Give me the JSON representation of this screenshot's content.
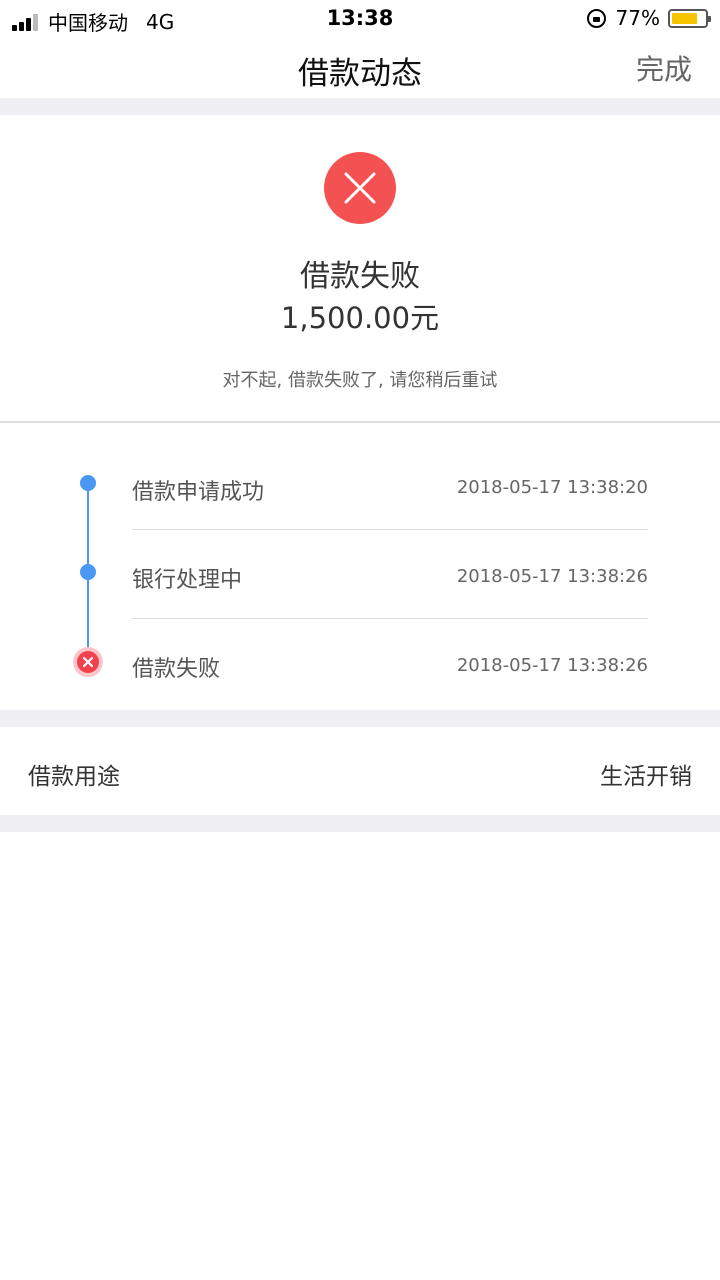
{
  "status_bar": {
    "carrier": "中国移动",
    "network": "4G",
    "time": "13:38",
    "battery": "77%",
    "battery_level": 0.77
  },
  "nav": {
    "title": "借款动态",
    "done_label": "完成"
  },
  "result": {
    "title": "借款失败",
    "amount": "1,500.00元",
    "message": "对不起, 借款失败了, 请您稍后重试"
  },
  "timeline": [
    {
      "label": "借款申请成功",
      "time": "2018-05-17 13:38:20",
      "state": "done"
    },
    {
      "label": "银行处理中",
      "time": "2018-05-17 13:38:26",
      "state": "done"
    },
    {
      "label": "借款失败",
      "time": "2018-05-17 13:38:26",
      "state": "failed"
    }
  ],
  "purpose": {
    "label": "借款用途",
    "value": "生活开销"
  },
  "colors": {
    "accent_blue": "#4a97f4",
    "fail_red": "#f45252",
    "battery_yellow": "#f7c500",
    "gap_gray": "#efeff4"
  }
}
